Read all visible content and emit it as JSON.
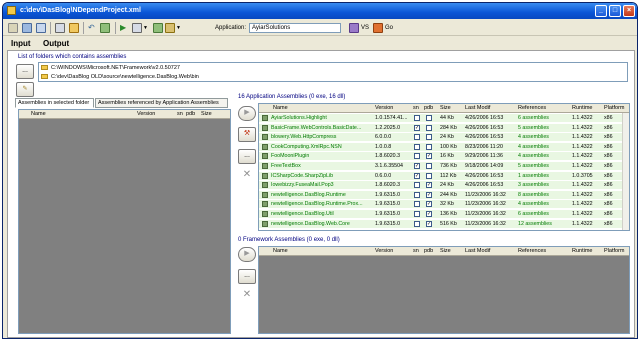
{
  "window": {
    "title": "c:\\dev\\DasBlog\\NDependProject.xml"
  },
  "toolbar": {
    "app_label": "Application:",
    "app_value": "AyiarSolutions",
    "vs_label": "VS",
    "go_label": "Go"
  },
  "tabs": [
    {
      "label": "Input"
    },
    {
      "label": "Output"
    }
  ],
  "folders_section": {
    "label": "List of folders which contains assemblies",
    "items": [
      "C:\\WINDOWS\\Microsoft.NET\\Framework\\v2.0.50727",
      "C:\\dev\\DasBlog OLD\\source\\newtelligence.DasBlog.Web\\bin"
    ]
  },
  "left_tabs": [
    "Assemblies in selected folder",
    "Assemblies referenced by Application Assemblies"
  ],
  "left_columns": [
    "Name",
    "Version",
    "sn",
    "pdb",
    "Size"
  ],
  "app_assemblies": {
    "title": "16 Application Assemblies  (0 exe, 16 dll)",
    "columns": [
      "Name",
      "Version",
      "sn",
      "pdb",
      "Size",
      "Last Modif",
      "References",
      "Runtime",
      "Platform"
    ],
    "rows": [
      {
        "name": "AyiarSolutions.Highlight",
        "version": "1.0.1574.41...",
        "sn": false,
        "pdb": false,
        "size": "44 Kb",
        "modif": "4/26/2006 16:53",
        "refs": "6 assemblies",
        "runtime": "1.1.4322",
        "platform": "x86"
      },
      {
        "name": "BasicFrame.WebControls.BasicDate...",
        "version": "1.2.2025.0",
        "sn": true,
        "pdb": false,
        "size": "284 Kb",
        "modif": "4/26/2006 16:53",
        "refs": "5 assemblies",
        "runtime": "1.1.4322",
        "platform": "x86"
      },
      {
        "name": "blowery.Web.HttpCompress",
        "version": "6.0.0.0",
        "sn": false,
        "pdb": false,
        "size": "24 Kb",
        "modif": "4/26/2006 16:53",
        "refs": "4 assemblies",
        "runtime": "1.1.4322",
        "platform": "x86"
      },
      {
        "name": "CookComputing.XmlRpc.NSN",
        "version": "1.0.0.8",
        "sn": false,
        "pdb": false,
        "size": "100 Kb",
        "modif": "8/23/2006 11:20",
        "refs": "4 assemblies",
        "runtime": "1.1.4322",
        "platform": "x86"
      },
      {
        "name": "FooMooniPlugin",
        "version": "1.8.6020.3",
        "sn": false,
        "pdb": true,
        "size": "16 Kb",
        "modif": "9/29/2006 11:36",
        "refs": "4 assemblies",
        "runtime": "1.1.4322",
        "platform": "x86"
      },
      {
        "name": "FreeTextBox",
        "version": "3.1.6.35504",
        "sn": true,
        "pdb": false,
        "size": "736 Kb",
        "modif": "9/18/2006 14:09",
        "refs": "5 assemblies",
        "runtime": "1.1.4322",
        "platform": "x86"
      },
      {
        "name": "ICSharpCode.SharpZipLib",
        "version": "0.6.0.0",
        "sn": true,
        "pdb": false,
        "size": "112 Kb",
        "modif": "4/26/2006 16:53",
        "refs": "1 assemblies",
        "runtime": "1.0.3705",
        "platform": "x86"
      },
      {
        "name": "Iowebizzy.FuseaMail.Pop3",
        "version": "1.8.6020.3",
        "sn": false,
        "pdb": true,
        "size": "24 Kb",
        "modif": "4/26/2006 16:53",
        "refs": "3 assemblies",
        "runtime": "1.1.4322",
        "platform": "x86"
      },
      {
        "name": "newtelligence.DasBlog.Runtime",
        "version": "1.9.6315.0",
        "sn": false,
        "pdb": true,
        "size": "244 Kb",
        "modif": "11/23/2006 16:32",
        "refs": "8 assemblies",
        "runtime": "1.1.4322",
        "platform": "x86"
      },
      {
        "name": "newtelligence.DasBlog.Runtime.Prox...",
        "version": "1.9.6315.0",
        "sn": false,
        "pdb": true,
        "size": "32 Kb",
        "modif": "11/23/2006 16:32",
        "refs": "4 assemblies",
        "runtime": "1.1.4322",
        "platform": "x86"
      },
      {
        "name": "newtelligence.DasBlog.Util",
        "version": "1.9.6315.0",
        "sn": false,
        "pdb": true,
        "size": "136 Kb",
        "modif": "11/23/2006 16:32",
        "refs": "6 assemblies",
        "runtime": "1.1.4322",
        "platform": "x86"
      },
      {
        "name": "newtelligence.DasBlog.Web.Core",
        "version": "1.9.6315.0",
        "sn": false,
        "pdb": true,
        "size": "516 Kb",
        "modif": "11/23/2006 16:32",
        "refs": "12 assemblies",
        "runtime": "1.1.4322",
        "platform": "x86"
      }
    ]
  },
  "fw_assemblies": {
    "title": "0 Framework Assemblies  (0 exe, 0 dll)",
    "columns": [
      "Name",
      "Version",
      "sn",
      "pdb",
      "Size",
      "Last Modif",
      "References",
      "Runtime",
      "Platform"
    ]
  },
  "buttons": {
    "browse": "...",
    "add_folder": "..."
  }
}
